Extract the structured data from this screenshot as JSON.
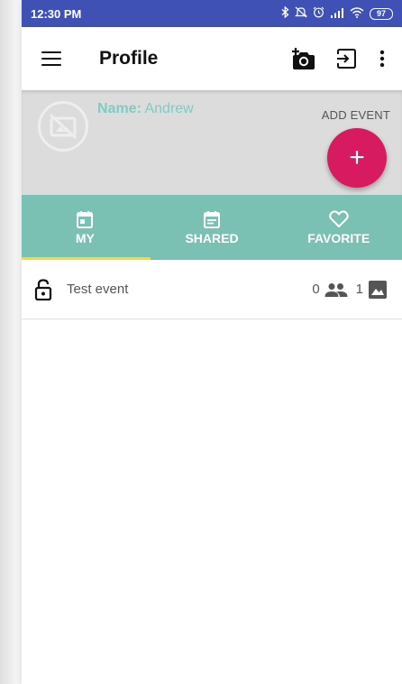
{
  "status_bar": {
    "time": "12:30 PM",
    "battery": "97",
    "icons": [
      "bluetooth-icon",
      "mute-icon",
      "alarm-icon",
      "signal-icon",
      "wifi-icon",
      "battery-icon"
    ]
  },
  "app_bar": {
    "title": "Profile",
    "icons": [
      "menu-icon",
      "add-photo-icon",
      "logout-icon",
      "more-vert-icon"
    ]
  },
  "profile": {
    "name_label": "Name:",
    "name_value": "Andrew",
    "add_event_label": "ADD EVENT",
    "fab_label": "+"
  },
  "tabs": [
    {
      "label": "MY",
      "icon": "calendar-icon",
      "selected": true
    },
    {
      "label": "SHARED",
      "icon": "event-note-icon",
      "selected": false
    },
    {
      "label": "FAVORITE",
      "icon": "heart-outline-icon",
      "selected": false
    }
  ],
  "events": [
    {
      "name": "Test event",
      "participants": "0",
      "photos": "1",
      "icon": "lock-open-icon"
    }
  ],
  "colors": {
    "status_bar": "#3f51b5",
    "tab_bar": "#7ac1b3",
    "tab_indicator": "#fdd835",
    "fab": "#d81b60",
    "name_text": "#80cbc4",
    "header_bg": "#dcdcdc"
  }
}
